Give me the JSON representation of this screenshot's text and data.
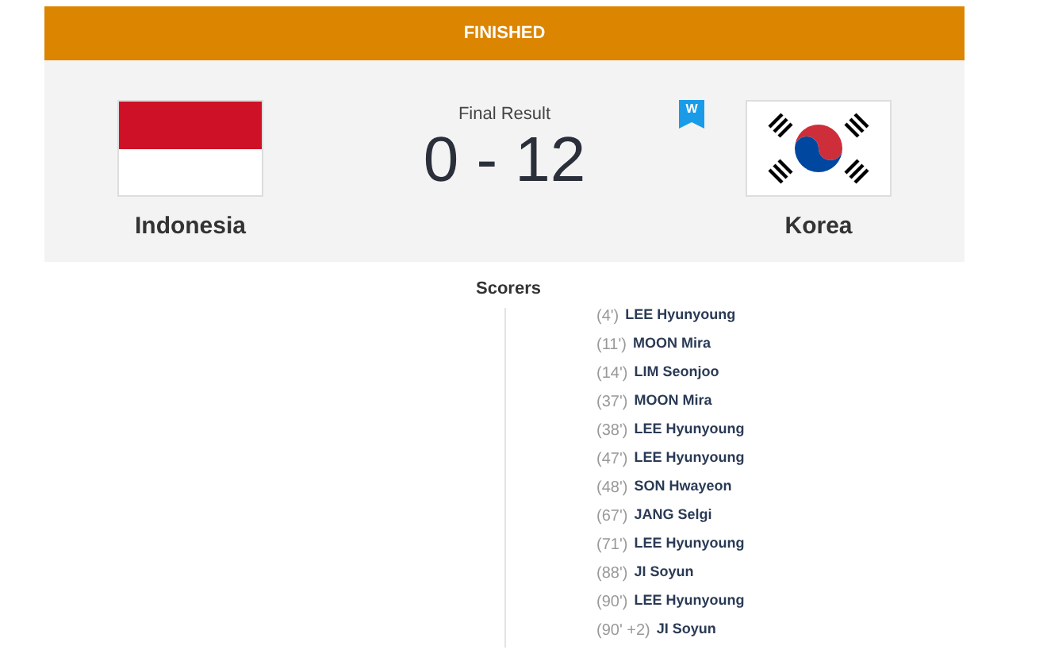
{
  "status_bar": {
    "label": "FINISHED"
  },
  "match": {
    "home": {
      "name": "Indonesia"
    },
    "result_label": "Final Result",
    "score": "0 - 12",
    "badge": "W",
    "away": {
      "name": "Korea"
    }
  },
  "scorers": {
    "title": "Scorers",
    "away": [
      {
        "minute": "(4')",
        "name": "LEE Hyunyoung"
      },
      {
        "minute": "(11')",
        "name": "MOON Mira"
      },
      {
        "minute": "(14')",
        "name": "LIM Seonjoo"
      },
      {
        "minute": "(37')",
        "name": "MOON Mira"
      },
      {
        "minute": "(38')",
        "name": "LEE Hyunyoung"
      },
      {
        "minute": "(47')",
        "name": "LEE Hyunyoung"
      },
      {
        "minute": "(48')",
        "name": "SON Hwayeon"
      },
      {
        "minute": "(67')",
        "name": "JANG Selgi"
      },
      {
        "minute": "(71')",
        "name": "LEE Hyunyoung"
      },
      {
        "minute": "(88')",
        "name": "JI Soyun"
      },
      {
        "minute": "(90')",
        "name": "LEE Hyunyoung"
      },
      {
        "minute": "(90' +2)",
        "name": "JI Soyun"
      }
    ]
  }
}
